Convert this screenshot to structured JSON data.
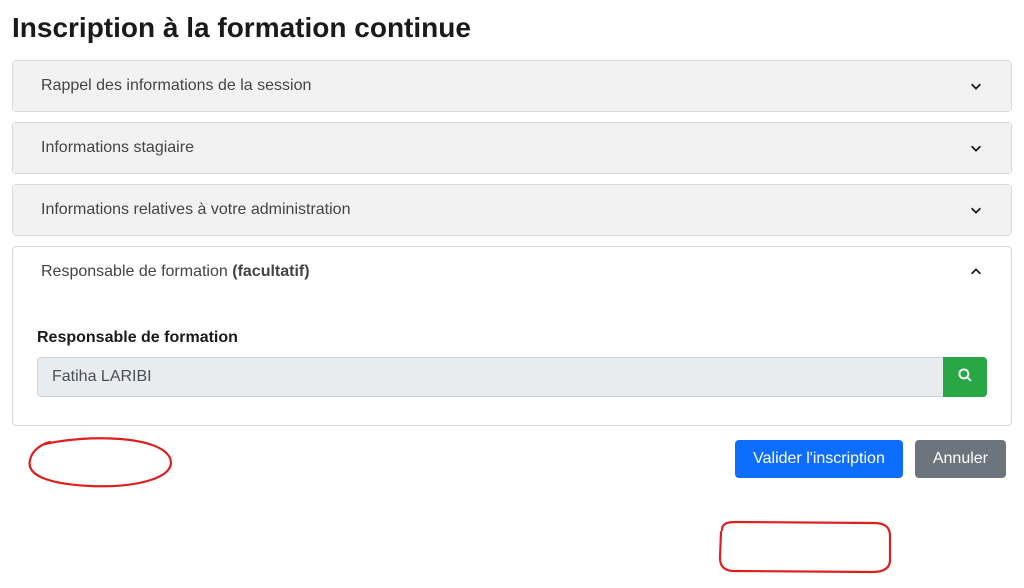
{
  "page_title": "Inscription à la formation continue",
  "sections": {
    "session_recap": "Rappel des informations de la session",
    "trainee_info": "Informations stagiaire",
    "admin_info": "Informations relatives à votre administration",
    "responsible": {
      "header_prefix": "Responsable de formation ",
      "header_suffix": "(facultatif)",
      "field_label": "Responsable de formation",
      "field_value": "Fatiha LARIBI"
    }
  },
  "actions": {
    "validate": "Valider l'inscription",
    "cancel": "Annuler"
  }
}
